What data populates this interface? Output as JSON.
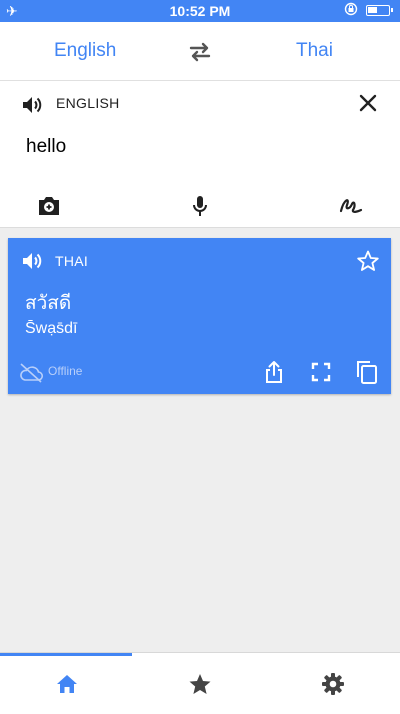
{
  "status_bar": {
    "airplane_icon": "airplane-icon",
    "time": "10:52 PM",
    "orientation_lock_icon": "orientation-lock-icon",
    "battery_icon": "battery-icon",
    "battery_level": 0.4
  },
  "language_bar": {
    "source_language": "English",
    "target_language": "Thai",
    "swap_icon": "swap-arrows-icon"
  },
  "input": {
    "language_label": "ENGLISH",
    "text": "hello",
    "speaker_icon": "speaker-icon",
    "clear_icon": "close-icon",
    "tools": [
      {
        "icon": "camera-icon"
      },
      {
        "icon": "microphone-icon"
      },
      {
        "icon": "handwriting-icon"
      }
    ]
  },
  "result": {
    "language_label": "THAI",
    "translation": "สวัสดี",
    "transliteration": "S̄wạs̄dī",
    "status": "Offline",
    "star_icon": "star-outline-icon",
    "actions": [
      {
        "icon": "share-icon"
      },
      {
        "icon": "fullscreen-icon"
      },
      {
        "icon": "copy-icon"
      }
    ]
  },
  "tab_bar": {
    "tabs": [
      {
        "icon": "home-icon",
        "active": true
      },
      {
        "icon": "star-icon",
        "active": false
      },
      {
        "icon": "gear-icon",
        "active": false
      }
    ]
  },
  "colors": {
    "accent": "#4285f4",
    "icon_gray": "#444444"
  }
}
